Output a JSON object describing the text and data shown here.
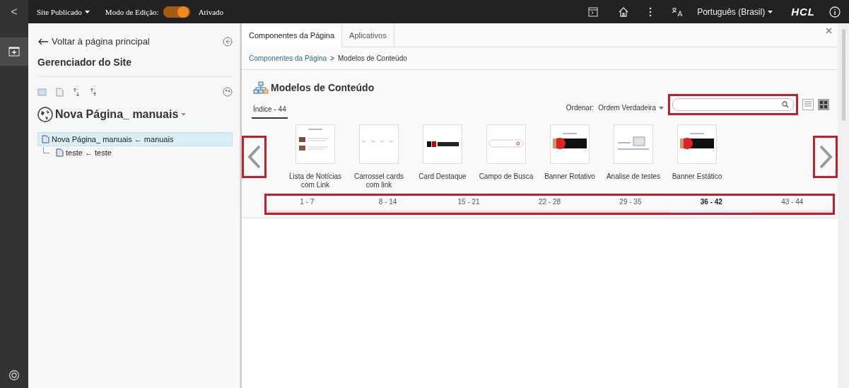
{
  "topbar": {
    "back": "<",
    "site": "Site Publicado",
    "edit_label": "Modo de Edição:",
    "edit_mode": {
      "on": true
    },
    "edit_state": "Ativado",
    "language": "Português (Brasil)",
    "brand": "HCL"
  },
  "sidebar": {
    "back_link": "Voltar à página principal",
    "title": "Gerenciador do Site",
    "page_title": "Nova Página_ manuais",
    "tree": [
      {
        "label": "Nova Página_ manuais ← manuais",
        "selected": true,
        "children": [
          {
            "label": "teste ← teste",
            "selected": false
          }
        ]
      }
    ]
  },
  "panel": {
    "tabs": [
      {
        "label": "Componentes da Página",
        "selected": true
      },
      {
        "label": "Aplicativos",
        "selected": false
      }
    ],
    "breadcrumb": {
      "link": "Componentes da Página",
      "separator": ">",
      "current": "Modelos de Conteúdo"
    },
    "heading": "Modelos de Conteúdo",
    "index_tab": "Índice - 44",
    "sort_label": "Ordenar:",
    "sort_value": "Ordem Verdadeira",
    "view": {
      "grid": true
    },
    "templates": [
      {
        "name": "Lista de Notícias com Link",
        "kind": "news"
      },
      {
        "name": "Carrossel cards com link",
        "kind": "cards"
      },
      {
        "name": "Card Destaque",
        "kind": "logo"
      },
      {
        "name": "Campo de Busca",
        "kind": "search"
      },
      {
        "name": "Banner Rotativo",
        "kind": "banner"
      },
      {
        "name": "Analise de testes",
        "kind": "laptop"
      },
      {
        "name": "Banner Estático",
        "kind": "banner"
      }
    ],
    "pages": [
      {
        "label": "1 - 7",
        "selected": false
      },
      {
        "label": "8 - 14",
        "selected": false
      },
      {
        "label": "15 - 21",
        "selected": false
      },
      {
        "label": "22 - 28",
        "selected": false
      },
      {
        "label": "29 - 35",
        "selected": false
      },
      {
        "label": "36 - 42",
        "selected": true
      },
      {
        "label": "43 - 44",
        "selected": false
      }
    ]
  }
}
